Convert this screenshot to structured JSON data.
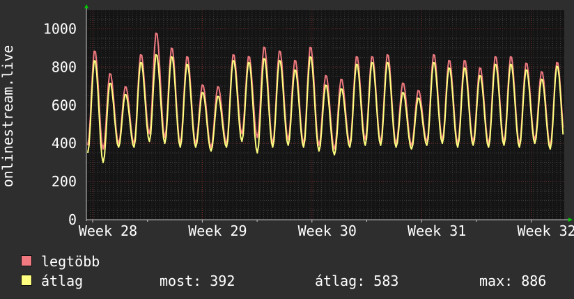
{
  "chart_data": {
    "type": "line",
    "ylabel": "onlinestream.live",
    "ylim": [
      0,
      1100
    ],
    "yticks": [
      0,
      200,
      400,
      600,
      800,
      1000
    ],
    "x_tick_labels": [
      "Week 28",
      "Week 29",
      "Week 30",
      "Week 31",
      "Week 32"
    ],
    "grid": true,
    "legend_position": "bottom-left",
    "series": [
      {
        "name": "legtöbb",
        "color": "#f07a80",
        "daily_peaks": [
          890,
          770,
          700,
          870,
          985,
          905,
          860,
          710,
          700,
          870,
          860,
          910,
          890,
          840,
          910,
          760,
          740,
          860,
          860,
          870,
          720,
          680,
          870,
          840,
          840,
          800,
          860,
          860,
          825,
          780,
          830
        ],
        "daily_troughs": [
          390,
          370,
          400,
          400,
          450,
          430,
          400,
          400,
          380,
          400,
          450,
          430,
          400,
          420,
          400,
          390,
          370,
          400,
          420,
          410,
          400,
          390,
          410,
          420,
          400,
          410,
          400,
          410,
          400,
          420,
          390
        ]
      },
      {
        "name": "átlag",
        "color": "#ffff80",
        "daily_peaks": [
          840,
          720,
          660,
          830,
          870,
          860,
          820,
          670,
          650,
          840,
          830,
          850,
          840,
          790,
          860,
          710,
          690,
          820,
          830,
          830,
          670,
          640,
          830,
          800,
          800,
          760,
          820,
          820,
          790,
          740,
          810
        ],
        "daily_troughs": [
          350,
          300,
          380,
          380,
          410,
          400,
          380,
          380,
          360,
          380,
          410,
          350,
          380,
          390,
          380,
          360,
          340,
          380,
          390,
          390,
          380,
          370,
          390,
          400,
          380,
          390,
          380,
          390,
          380,
          400,
          370
        ]
      }
    ]
  },
  "legend": [
    {
      "label": "legtöbb",
      "color": "#f07a80"
    },
    {
      "label": "átlag",
      "color": "#ffff80"
    }
  ],
  "stats": {
    "most": "most: 392",
    "atlag": "átlag: 583",
    "max": "max: 886"
  },
  "colors": {
    "background": "#2e2e2e",
    "plot_background": "#141414",
    "axis": "#c8c8c8",
    "arrow": "#00cc00",
    "major_grid": "#7a2a2a",
    "minor_grid": "#3c3c3c"
  }
}
